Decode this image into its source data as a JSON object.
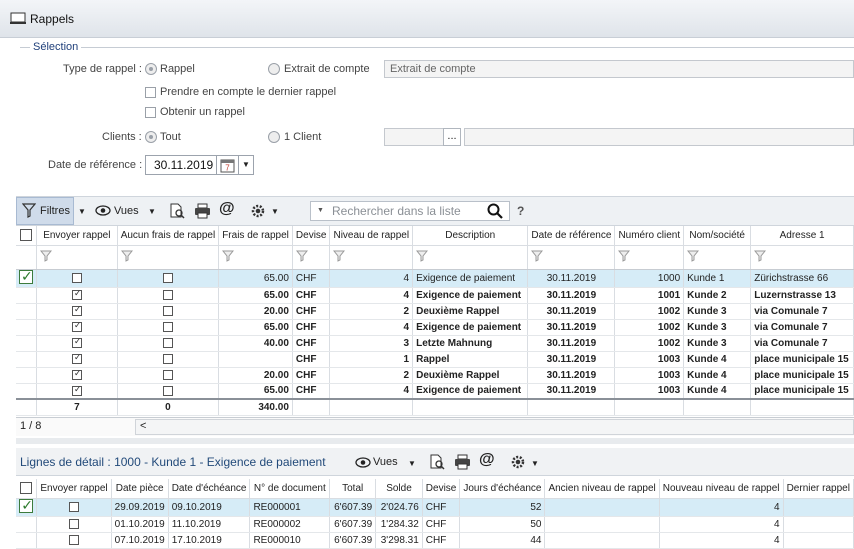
{
  "window": {
    "title": "Rappels"
  },
  "selection": {
    "legend": "Sélection",
    "type_label": "Type de rappel :",
    "opt_rappel": "Rappel",
    "opt_extrait": "Extrait de compte",
    "extrait_value": "Extrait de compte",
    "chk_dernier": "Prendre en compte le dernier rappel",
    "chk_obtenir": "Obtenir un rappel",
    "clients_label": "Clients :",
    "opt_tout": "Tout",
    "opt_1client": "1 Client",
    "ellipsis": "...",
    "date_label": "Date de référence :",
    "date_value": "30.11.2019",
    "calendar_day": "7"
  },
  "toolbar": {
    "filtres": "Filtres",
    "vues": "Vues",
    "search_placeholder": "Rechercher dans la liste",
    "help": "?"
  },
  "grid": {
    "headers": [
      "Envoyer rappel",
      "Aucun frais de rappel",
      "Frais de rappel",
      "Devise",
      "Niveau de rappel",
      "Description",
      "Date de référence",
      "Numéro client",
      "Nom/société",
      "Adresse 1"
    ],
    "rows": [
      {
        "envoyer": false,
        "aucun": false,
        "frais": "65.00",
        "devise": "CHF",
        "niveau": "4",
        "desc": "Exigence de paiement",
        "date": "30.11.2019",
        "num": "1000",
        "nom": "Kunde 1",
        "adr": "Zürichstrasse 66"
      },
      {
        "envoyer": true,
        "aucun": false,
        "frais": "65.00",
        "devise": "CHF",
        "niveau": "4",
        "desc": "Exigence de paiement",
        "date": "30.11.2019",
        "num": "1001",
        "nom": "Kunde 2",
        "adr": "Luzernstrasse 13"
      },
      {
        "envoyer": true,
        "aucun": false,
        "frais": "20.00",
        "devise": "CHF",
        "niveau": "2",
        "desc": "Deuxième Rappel",
        "date": "30.11.2019",
        "num": "1002",
        "nom": "Kunde 3",
        "adr": "via Comunale 7"
      },
      {
        "envoyer": true,
        "aucun": false,
        "frais": "65.00",
        "devise": "CHF",
        "niveau": "4",
        "desc": "Exigence de paiement",
        "date": "30.11.2019",
        "num": "1002",
        "nom": "Kunde 3",
        "adr": "via Comunale 7"
      },
      {
        "envoyer": true,
        "aucun": false,
        "frais": "40.00",
        "devise": "CHF",
        "niveau": "3",
        "desc": "Letzte Mahnung",
        "date": "30.11.2019",
        "num": "1002",
        "nom": "Kunde 3",
        "adr": "via Comunale 7"
      },
      {
        "envoyer": true,
        "aucun": false,
        "frais": "",
        "devise": "CHF",
        "niveau": "1",
        "desc": "Rappel",
        "date": "30.11.2019",
        "num": "1003",
        "nom": "Kunde 4",
        "adr": "place municipale 15"
      },
      {
        "envoyer": true,
        "aucun": false,
        "frais": "20.00",
        "devise": "CHF",
        "niveau": "2",
        "desc": "Deuxième Rappel",
        "date": "30.11.2019",
        "num": "1003",
        "nom": "Kunde 4",
        "adr": "place municipale 15"
      },
      {
        "envoyer": true,
        "aucun": false,
        "frais": "65.00",
        "devise": "CHF",
        "niveau": "4",
        "desc": "Exigence de paiement",
        "date": "30.11.2019",
        "num": "1003",
        "nom": "Kunde 4",
        "adr": "place municipale 15"
      }
    ],
    "totals": {
      "envoyer": "7",
      "aucun": "0",
      "frais": "340.00"
    },
    "pager": "1 / 8",
    "scroll_left": "<"
  },
  "detail": {
    "title": "Lignes de détail : 1000 - Kunde 1 - Exigence de paiement",
    "vues": "Vues",
    "headers": [
      "Envoyer rappel",
      "Date pièce",
      "Date d'échéance",
      "N° de document",
      "Total",
      "Solde",
      "Devise",
      "Jours d'échéance",
      "Ancien niveau de rappel",
      "Nouveau niveau de rappel",
      "Dernier rappel"
    ],
    "rows": [
      {
        "envoyer": false,
        "date_piece": "29.09.2019",
        "echeance": "09.10.2019",
        "doc": "RE000001",
        "total": "6'607.39",
        "solde": "2'024.76",
        "devise": "CHF",
        "jours": "52",
        "ancien": "",
        "nouveau": "4",
        "dernier": ""
      },
      {
        "envoyer": false,
        "date_piece": "01.10.2019",
        "echeance": "11.10.2019",
        "doc": "RE000002",
        "total": "6'607.39",
        "solde": "1'284.32",
        "devise": "CHF",
        "jours": "50",
        "ancien": "",
        "nouveau": "4",
        "dernier": ""
      },
      {
        "envoyer": false,
        "date_piece": "07.10.2019",
        "echeance": "17.10.2019",
        "doc": "RE000010",
        "total": "6'607.39",
        "solde": "3'298.31",
        "devise": "CHF",
        "jours": "44",
        "ancien": "",
        "nouveau": "4",
        "dernier": ""
      }
    ]
  }
}
